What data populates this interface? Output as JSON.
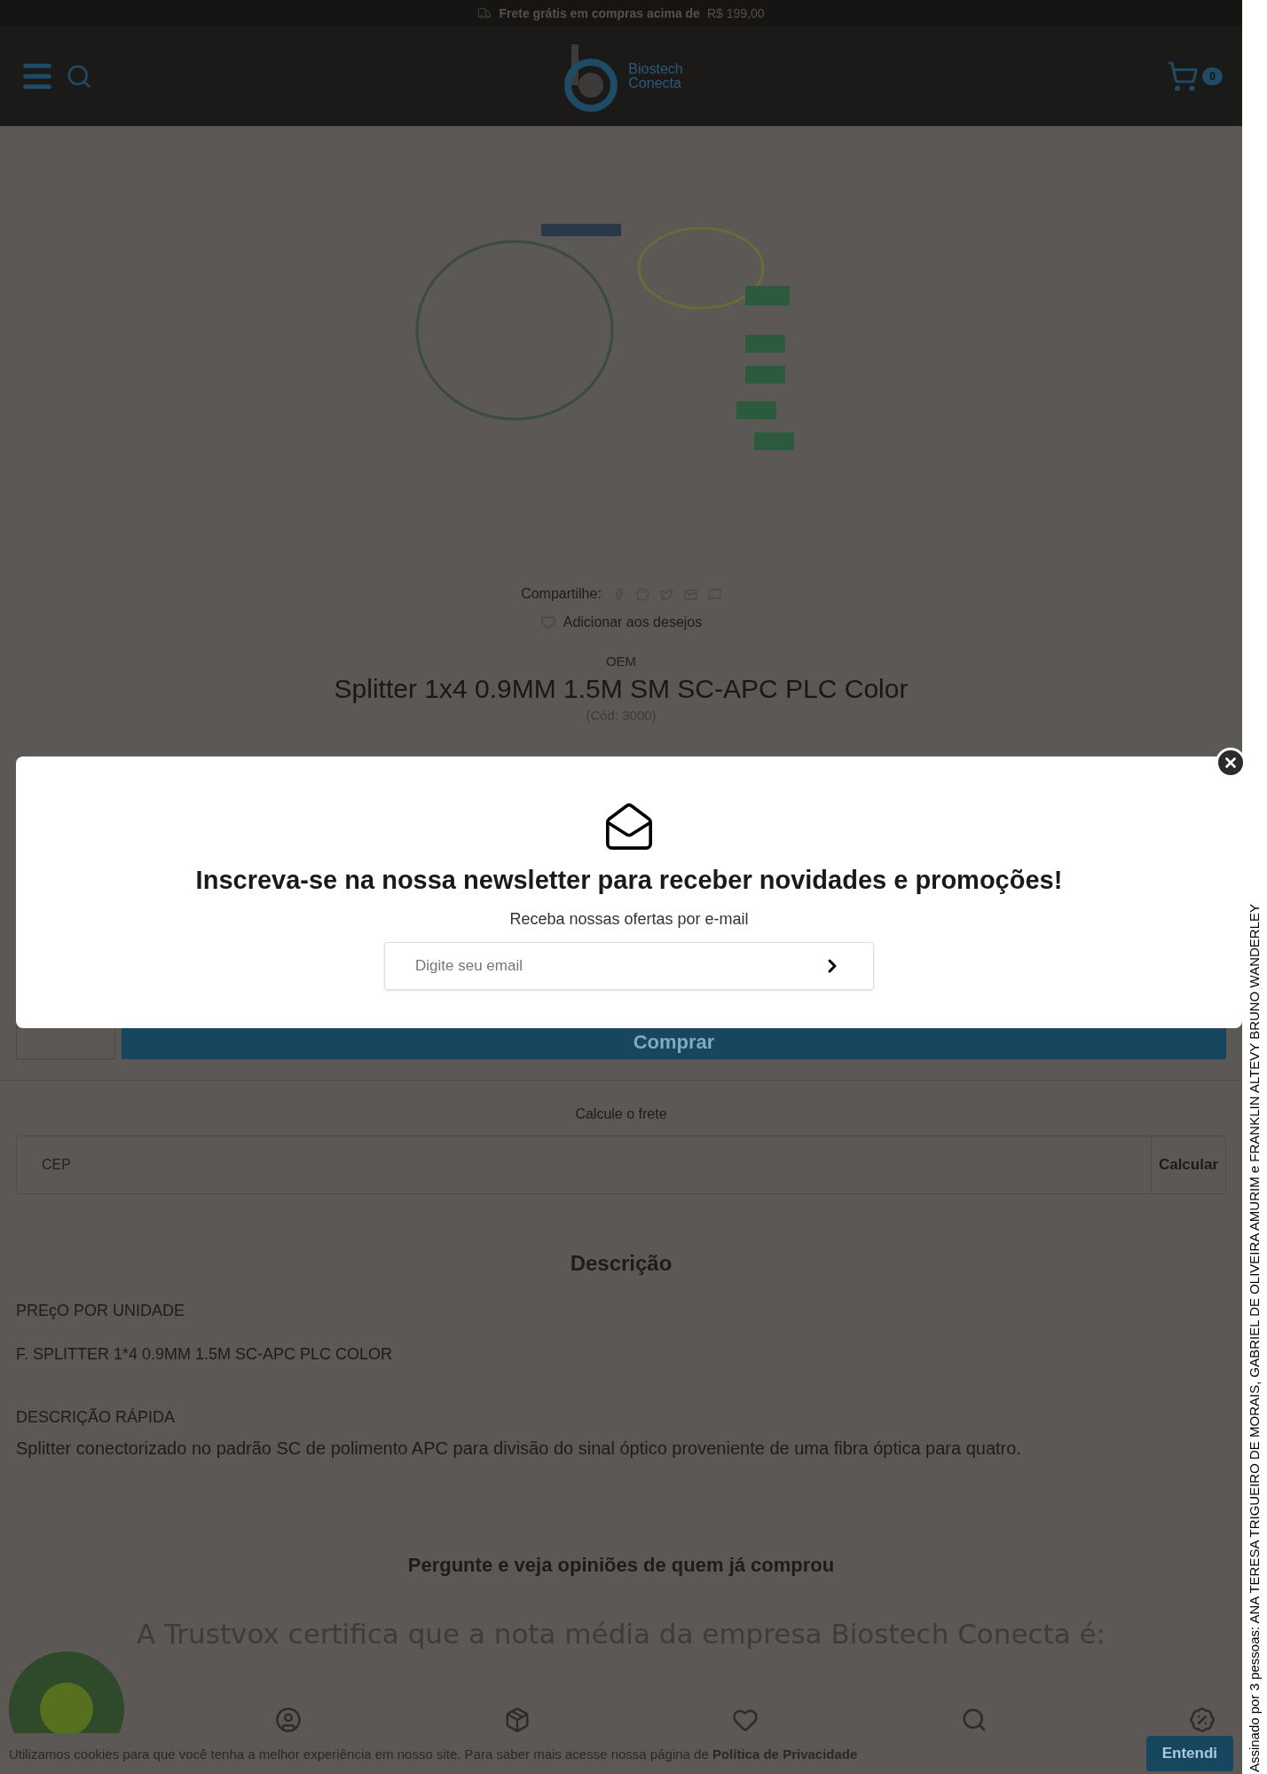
{
  "announcement": {
    "text": "Frete grátis em compras acima de",
    "price": "R$ 199,00"
  },
  "header": {
    "logo_lines": [
      "Biostech",
      "Conecta"
    ],
    "cart_count": "0"
  },
  "share": {
    "label": "Compartilhe:",
    "wishlist": "Adicionar aos desejos"
  },
  "product": {
    "brand": "OEM",
    "title": "Splitter 1x4 0.9MM 1.5M SM SC-APC PLC Color",
    "code": "(Cód: 3000)",
    "buy_button": "Comprar"
  },
  "shipping": {
    "title": "Calcule o frete",
    "placeholder": "CEP",
    "button": "Calcular"
  },
  "description": {
    "title": "Descrição",
    "paragraphs": [
      "PREçO POR UNIDADE",
      "F. SPLITTER 1*4 0.9MM 1.5M SC-APC PLC COLOR"
    ],
    "subtitle": "DESCRIÇÃO RÁPIDA",
    "text": "Splitter conectorizado no padrão SC de polimento APC para divisão do sinal óptico proveniente de uma fibra óptica para quatro."
  },
  "reviews": {
    "title": "Pergunte e veja opiniões de quem já comprou",
    "trustvox": "A Trustvox certifica que a nota média da empresa Biostech Conecta é:"
  },
  "newsletter": {
    "title": "Inscreva-se na nossa newsletter para receber novidades e promoções!",
    "subtitle": "Receba nossas ofertas por e-mail",
    "placeholder": "Digite seu email"
  },
  "cookie": {
    "text": "Utilizamos cookies para que você tenha a melhor experiência em nosso site. Para saber mais acesse nossa página de **Política de Privacidade**",
    "button": "Entendi"
  },
  "signature": "Assinado por 3 pessoas:  ANA TERESA TRIGUEIRO DE MORAIS, GABRIEL DE OLIVEIRA AMURIM e FRANKLIN ALTEVY BRUNO WANDERLEY"
}
